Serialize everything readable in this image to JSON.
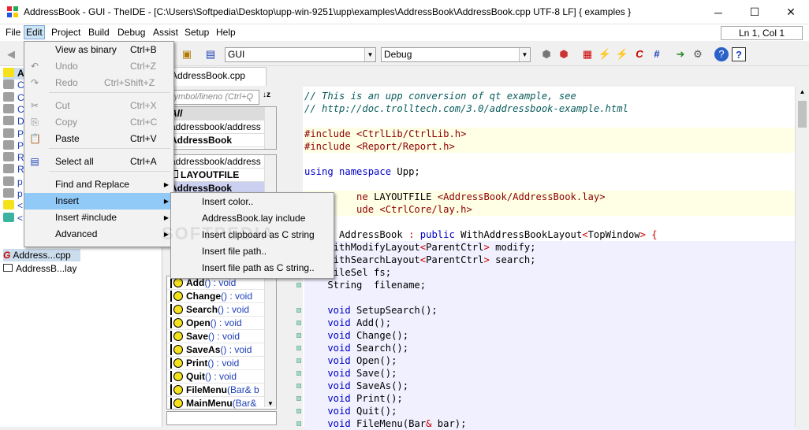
{
  "window": {
    "title": "AddressBook - GUI - TheIDE - [C:\\Users\\Softpedia\\Desktop\\upp-win-9251\\upp\\examples\\AddressBook\\AddressBook.cpp UTF-8 LF] { examples }",
    "min": "─",
    "max": "☐",
    "close": "✕"
  },
  "menubar": {
    "items": [
      "File",
      "Edit",
      "Project",
      "Build",
      "Debug",
      "Assist",
      "Setup",
      "Help"
    ]
  },
  "position": "Ln 1, Col 1",
  "toolbar": {
    "package_combo": "GUI",
    "config_combo": "Debug"
  },
  "tab": {
    "label": "AddressBook.cpp"
  },
  "left_panel": {
    "items": [
      {
        "label": "A",
        "color": "#f5e21b"
      },
      {
        "label": "C",
        "color": "#a0a0a0"
      },
      {
        "label": "C",
        "color": "#a0a0a0"
      },
      {
        "label": "C",
        "color": "#a0a0a0"
      },
      {
        "label": "D",
        "color": "#a0a0a0"
      },
      {
        "label": "P",
        "color": "#a0a0a0"
      },
      {
        "label": "P",
        "color": "#a0a0a0"
      },
      {
        "label": "R",
        "color": "#a0a0a0"
      },
      {
        "label": "R",
        "color": "#a0a0a0"
      },
      {
        "label": "p",
        "color": "#a0a0a0"
      },
      {
        "label": "p",
        "color": "#a0a0a0"
      },
      {
        "label": "<",
        "color": "#f5e21b"
      },
      {
        "label": "<",
        "color": "#3bb3a0"
      }
    ],
    "files": [
      {
        "name": "Address...cpp",
        "type": "G"
      },
      {
        "name": "AddressB...lay",
        "type": "L"
      }
    ]
  },
  "middle_panel": {
    "search_placeholder": "symbol/lineno (Ctrl+Q",
    "sort_icon": "↓z",
    "scopes": [
      "All",
      "addressbook/address",
      "AddressBook"
    ],
    "items": [
      "addressbook/address",
      "LAYOUTFILE",
      "AddressBook"
    ],
    "functions": [
      {
        "name": "Add",
        "sig": "() : void"
      },
      {
        "name": "Change",
        "sig": "() : void"
      },
      {
        "name": "Search",
        "sig": "() : void"
      },
      {
        "name": "Open",
        "sig": "() : void"
      },
      {
        "name": "Save",
        "sig": "() : void"
      },
      {
        "name": "SaveAs",
        "sig": "() : void"
      },
      {
        "name": "Print",
        "sig": "() : void"
      },
      {
        "name": "Quit",
        "sig": "() : void"
      },
      {
        "name": "FileMenu",
        "sig": "(Bar& b"
      },
      {
        "name": "MainMenu",
        "sig": "(Bar&"
      }
    ]
  },
  "editor": {
    "lines": [
      [
        {
          "t": "// This is an upp conversion of qt example, see",
          "c": "c-cmt"
        }
      ],
      [
        {
          "t": "// http://doc.trolltech.com/3.0/addressbook-example.html",
          "c": "c-cmt"
        }
      ],
      [],
      [
        {
          "t": "#include ",
          "c": "c-pp"
        },
        {
          "t": "<CtrlLib/CtrlLib.h>",
          "c": "c-str"
        }
      ],
      [
        {
          "t": "#include ",
          "c": "c-pp"
        },
        {
          "t": "<Report/Report.h>",
          "c": "c-str"
        }
      ],
      [],
      [
        {
          "t": "using namespace ",
          "c": "c-kw"
        },
        {
          "t": "Upp;",
          "c": "c-id"
        }
      ],
      [],
      [
        {
          "t": "         ne ",
          "c": "c-pp"
        },
        {
          "t": "LAYOUTFILE ",
          "c": "c-id"
        },
        {
          "t": "<AddressBook/AddressBook.lay>",
          "c": "c-str"
        }
      ],
      [
        {
          "t": "         ude ",
          "c": "c-pp"
        },
        {
          "t": "<CtrlCore/lay.h>",
          "c": "c-str"
        }
      ],
      [],
      [
        {
          "t": "      AddressBook ",
          "c": "c-id"
        },
        {
          "t": ": ",
          "c": "c-op"
        },
        {
          "t": "public ",
          "c": "c-kw"
        },
        {
          "t": "WithAddressBookLayout",
          "c": "c-id"
        },
        {
          "t": "<",
          "c": "c-op"
        },
        {
          "t": "TopWindow",
          "c": "c-id"
        },
        {
          "t": "> {",
          "c": "c-op"
        }
      ],
      [
        {
          "t": "    WithModifyLayout",
          "c": "c-id"
        },
        {
          "t": "<",
          "c": "c-op"
        },
        {
          "t": "ParentCtrl",
          "c": "c-id"
        },
        {
          "t": "> ",
          "c": "c-op"
        },
        {
          "t": "modify;",
          "c": "c-id"
        }
      ],
      [
        {
          "t": "    WithSearchLayout",
          "c": "c-id"
        },
        {
          "t": "<",
          "c": "c-op"
        },
        {
          "t": "ParentCtrl",
          "c": "c-id"
        },
        {
          "t": "> ",
          "c": "c-op"
        },
        {
          "t": "search;",
          "c": "c-id"
        }
      ],
      [
        {
          "t": "    FileSel fs;",
          "c": "c-id"
        }
      ],
      [
        {
          "t": "    String  filename;",
          "c": "c-id"
        }
      ],
      [],
      [
        {
          "t": "    void ",
          "c": "c-kw"
        },
        {
          "t": "SetupSearch();",
          "c": "c-id"
        }
      ],
      [
        {
          "t": "    void ",
          "c": "c-kw"
        },
        {
          "t": "Add();",
          "c": "c-id"
        }
      ],
      [
        {
          "t": "    void ",
          "c": "c-kw"
        },
        {
          "t": "Change();",
          "c": "c-id"
        }
      ],
      [
        {
          "t": "    void ",
          "c": "c-kw"
        },
        {
          "t": "Search();",
          "c": "c-id"
        }
      ],
      [
        {
          "t": "    void ",
          "c": "c-kw"
        },
        {
          "t": "Open();",
          "c": "c-id"
        }
      ],
      [
        {
          "t": "    void ",
          "c": "c-kw"
        },
        {
          "t": "Save();",
          "c": "c-id"
        }
      ],
      [
        {
          "t": "    void ",
          "c": "c-kw"
        },
        {
          "t": "SaveAs();",
          "c": "c-id"
        }
      ],
      [
        {
          "t": "    void ",
          "c": "c-kw"
        },
        {
          "t": "Print();",
          "c": "c-id"
        }
      ],
      [
        {
          "t": "    void ",
          "c": "c-kw"
        },
        {
          "t": "Quit();",
          "c": "c-id"
        }
      ],
      [
        {
          "t": "    void ",
          "c": "c-kw"
        },
        {
          "t": "FileMenu(Bar",
          "c": "c-id"
        },
        {
          "t": "& ",
          "c": "c-op"
        },
        {
          "t": "bar);",
          "c": "c-id"
        }
      ]
    ]
  },
  "edit_menu": {
    "items": [
      {
        "label": "View as binary",
        "shortcut": "Ctrl+B",
        "enabled": true,
        "icon": ""
      },
      {
        "label": "Undo",
        "shortcut": "Ctrl+Z",
        "enabled": false,
        "icon": "↶"
      },
      {
        "label": "Redo",
        "shortcut": "Ctrl+Shift+Z",
        "enabled": false,
        "icon": "↷"
      },
      {
        "label": "Cut",
        "shortcut": "Ctrl+X",
        "enabled": false,
        "icon": "✂"
      },
      {
        "label": "Copy",
        "shortcut": "Ctrl+C",
        "enabled": false,
        "icon": "⎘"
      },
      {
        "label": "Paste",
        "shortcut": "Ctrl+V",
        "enabled": true,
        "icon": "📋"
      },
      {
        "label": "Select all",
        "shortcut": "Ctrl+A",
        "enabled": true,
        "icon": "▤"
      },
      {
        "label": "Find and Replace",
        "shortcut": "",
        "enabled": true,
        "icon": "",
        "submenu": true
      },
      {
        "label": "Insert",
        "shortcut": "",
        "enabled": true,
        "icon": "",
        "submenu": true,
        "selected": true
      },
      {
        "label": "Insert #include",
        "shortcut": "",
        "enabled": true,
        "icon": "",
        "submenu": true
      },
      {
        "label": "Advanced",
        "shortcut": "",
        "enabled": true,
        "icon": "",
        "submenu": true
      }
    ]
  },
  "insert_submenu": {
    "items": [
      "Insert color..",
      "AddressBook.lay include",
      "Insert clipboard as C string",
      "Insert file path..",
      "Insert file path as C string.."
    ]
  }
}
